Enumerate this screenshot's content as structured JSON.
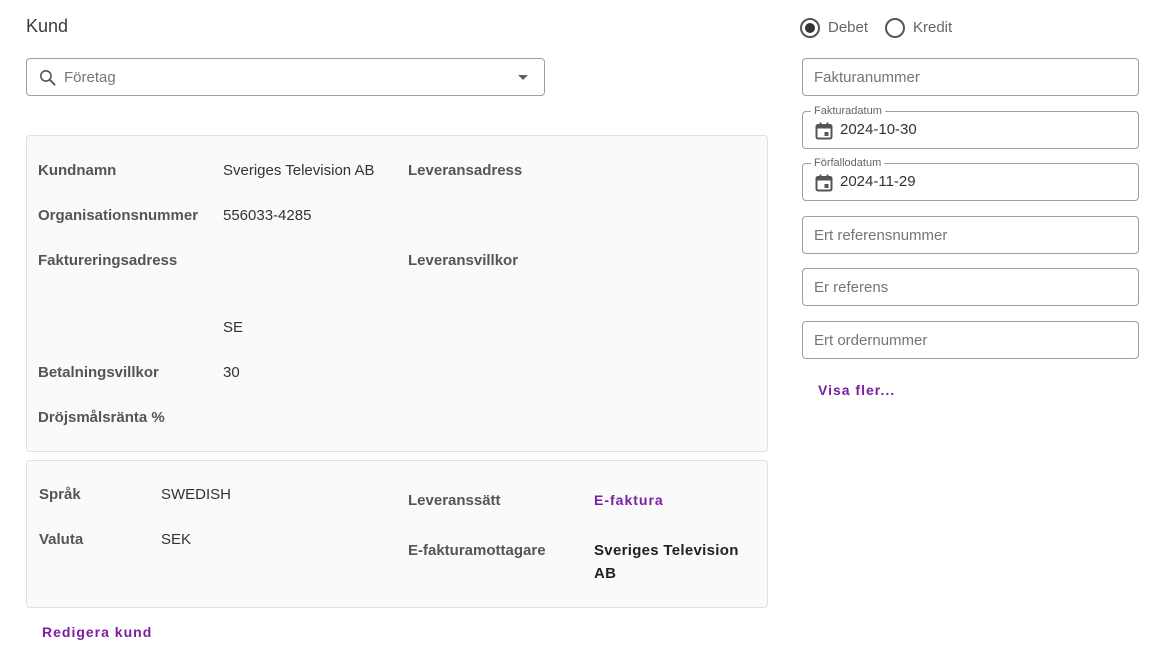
{
  "customer": {
    "title": "Kund",
    "search": {
      "placeholder": "Företag",
      "icon": "search-icon"
    },
    "details": {
      "name_label": "Kundnamn",
      "name_value": "Sveriges Television AB",
      "org_label": "Organisationsnummer",
      "org_value": "556033-4285",
      "billing_address_label": "Faktureringsadress",
      "country_value": "SE",
      "payment_terms_label": "Betalningsvillkor",
      "payment_terms_value": "30",
      "interest_label": "Dröjsmålsränta %",
      "delivery_address_label": "Leveransadress",
      "delivery_terms_label": "Leveransvillkor"
    },
    "settings": {
      "language_label": "Språk",
      "language_value": "SWEDISH",
      "currency_label": "Valuta",
      "currency_value": "SEK",
      "delivery_method_label": "Leveranssätt",
      "delivery_method_value": "E-faktura",
      "einvoice_recipient_label": "E-fakturamottagare",
      "einvoice_recipient_value": "Sveriges Television AB"
    },
    "edit_link": "Redigera kund"
  },
  "invoice": {
    "type_options": [
      {
        "label": "Debet",
        "selected": true
      },
      {
        "label": "Kredit",
        "selected": false
      }
    ],
    "fields": {
      "invoice_number_placeholder": "Fakturanummer",
      "invoice_date_label": "Fakturadatum",
      "invoice_date_value": "2024-10-30",
      "due_date_label": "Förfallodatum",
      "due_date_value": "2024-11-29",
      "your_ref_number_placeholder": "Ert referensnummer",
      "our_ref_placeholder": "Er referens",
      "your_order_number_placeholder": "Ert ordernummer"
    },
    "show_more_link": "Visa fler..."
  },
  "colors": {
    "link": "#7b1fa2",
    "card_bg": "#fafafa",
    "border": "#9e9e9e"
  }
}
